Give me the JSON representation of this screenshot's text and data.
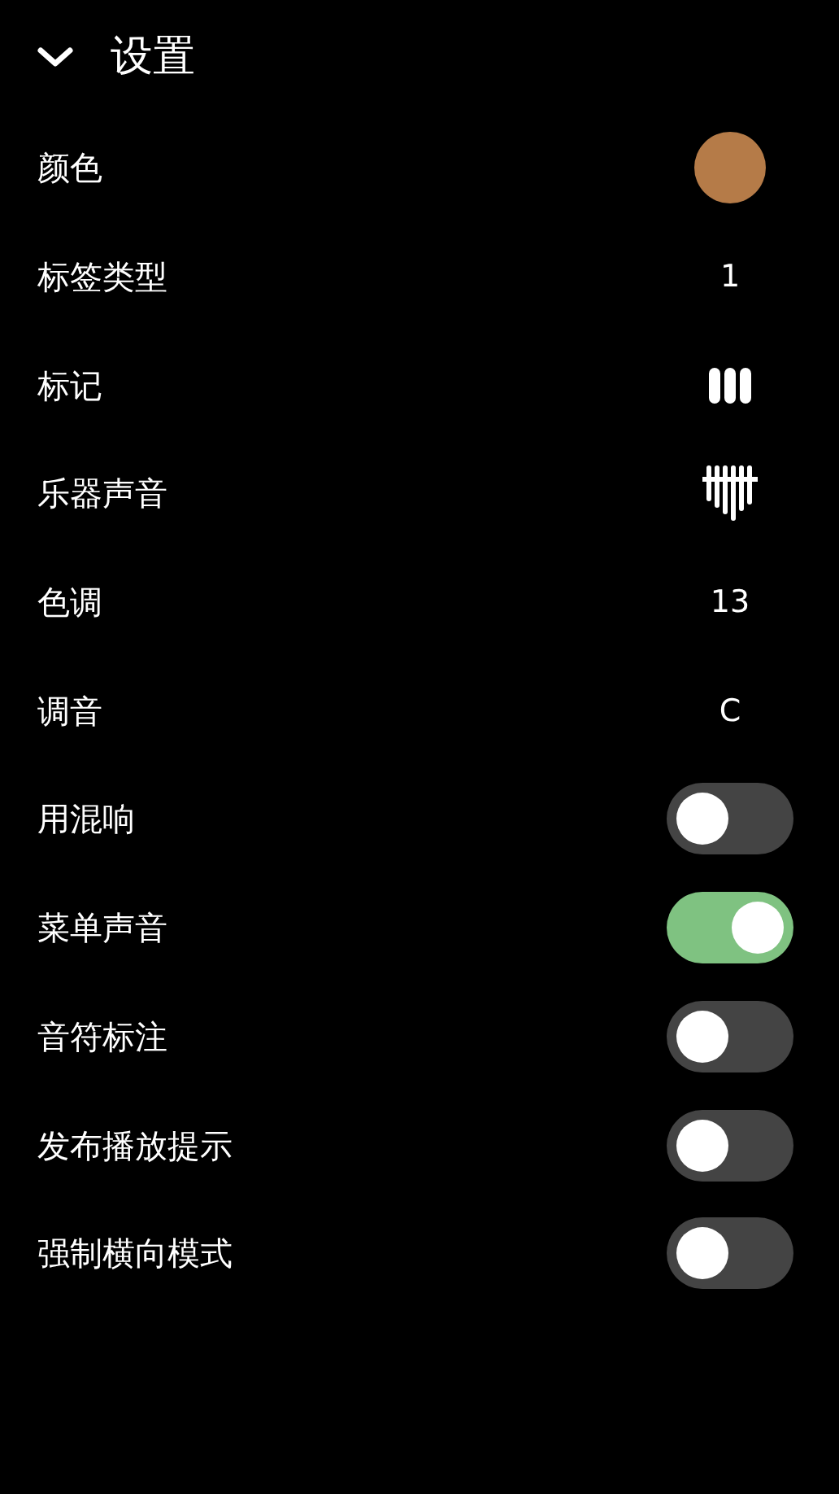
{
  "header": {
    "title": "设置",
    "expanded": true
  },
  "settings": [
    {
      "label": "颜色",
      "kind": "color",
      "color": "#b57b48"
    },
    {
      "label": "标签类型",
      "kind": "text",
      "value": "1"
    },
    {
      "label": "标记",
      "kind": "bars"
    },
    {
      "label": "乐器声音",
      "kind": "kalimba"
    },
    {
      "label": "色调",
      "kind": "text",
      "value": "13"
    },
    {
      "label": "调音",
      "kind": "text",
      "value": "C"
    },
    {
      "label": "用混响",
      "kind": "toggle",
      "on": false
    },
    {
      "label": "菜单声音",
      "kind": "toggle",
      "on": true
    },
    {
      "label": "音符标注",
      "kind": "toggle",
      "on": false
    },
    {
      "label": "发布播放提示",
      "kind": "toggle",
      "on": false
    },
    {
      "label": "强制横向模式",
      "kind": "toggle",
      "on": false
    }
  ]
}
